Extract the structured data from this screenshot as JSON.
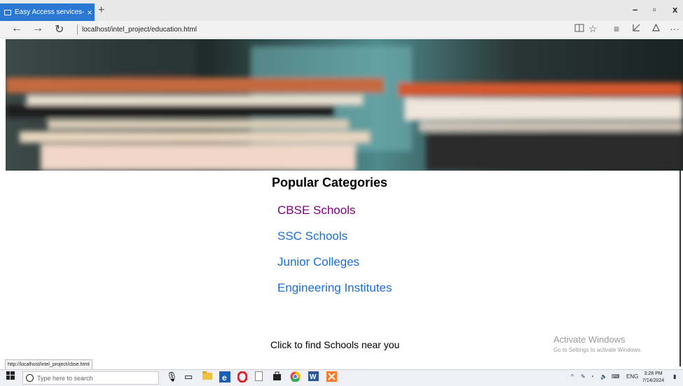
{
  "browser": {
    "tab_title": "Easy Access services-Ed",
    "tab_close": "×",
    "new_tab": "+",
    "url": "localhost/intel_project/education.html",
    "back": "←",
    "forward": "→",
    "refresh": "↻",
    "more": "···",
    "min": "–",
    "restore": "▫",
    "close": "x"
  },
  "page": {
    "heading": "Popular Categories",
    "categories": [
      {
        "label": "CBSE Schools",
        "state": "visited"
      },
      {
        "label": "SSC Schools",
        "state": "link"
      },
      {
        "label": "Junior Colleges",
        "state": "link"
      },
      {
        "label": "Engineering Institutes",
        "state": "link"
      }
    ],
    "find_link": "Click to find Schools near you"
  },
  "watermark": {
    "title": "Activate Windows",
    "subtitle": "Go to Settings to activate Windows."
  },
  "status_url": "http://localhost/intel_project/cbse.html",
  "taskbar": {
    "search_placeholder": "Type here to search",
    "lang": "ENG",
    "time": "3:28 PM",
    "date": "7/14/2024"
  },
  "colors": {
    "tab_accent": "#2b78d4",
    "link": "#1a6ed8",
    "visited": "#800080"
  }
}
